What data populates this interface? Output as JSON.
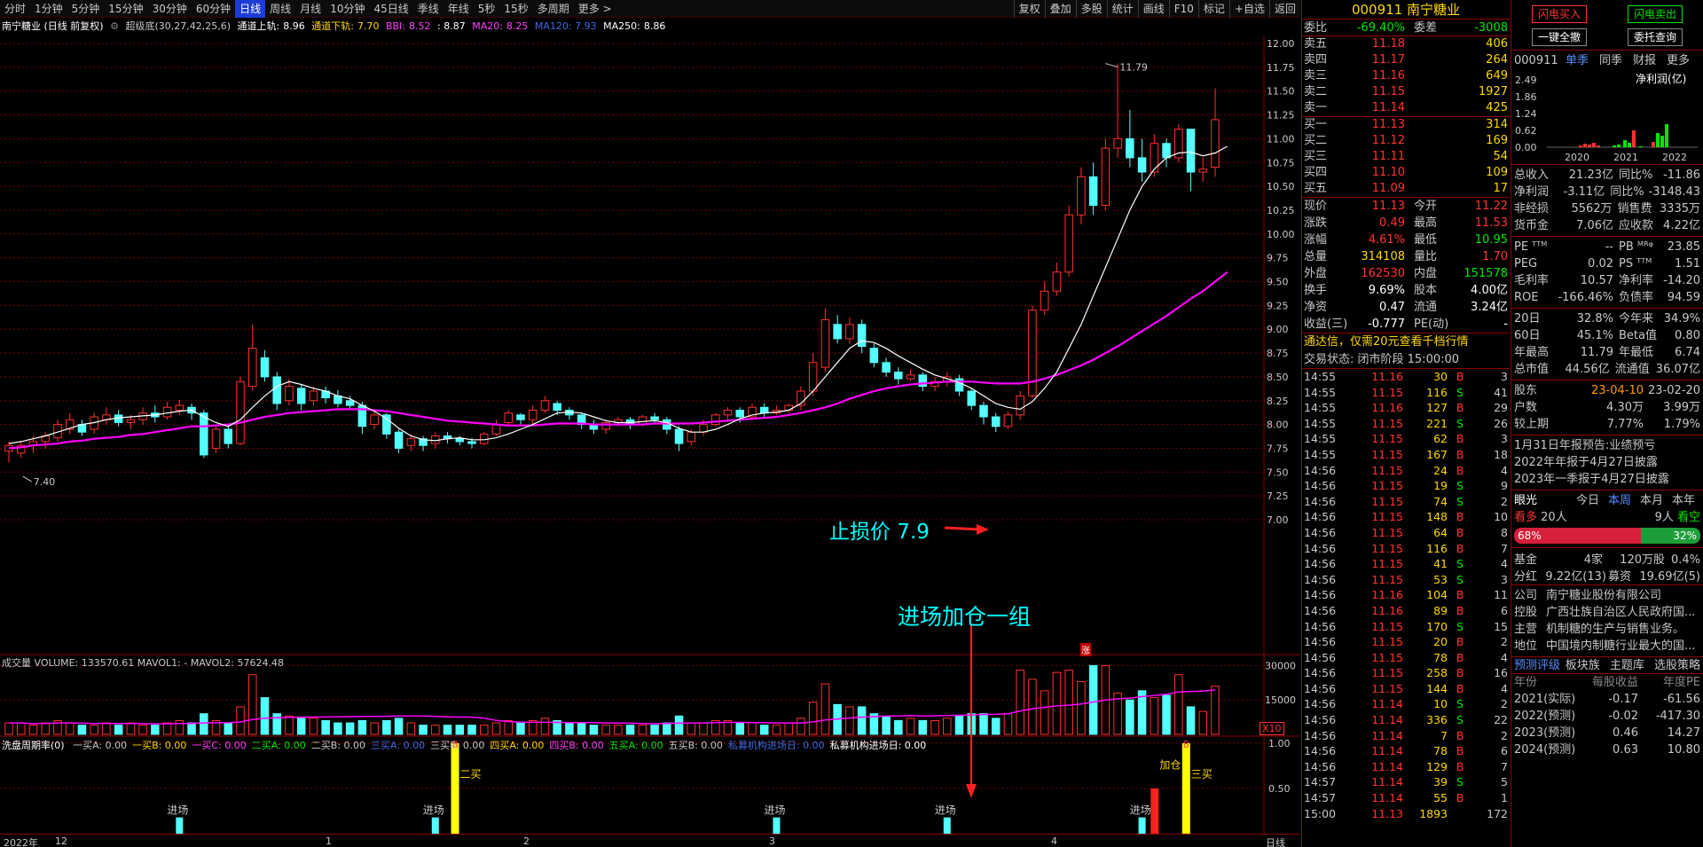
{
  "toolbar": {
    "tabs": [
      "分时",
      "1分钟",
      "5分钟",
      "15分钟",
      "30分钟",
      "60分钟",
      "日线",
      "周线",
      "月线",
      "10分钟",
      "45日线",
      "季线",
      "年线",
      "5秒",
      "15秒",
      "多周期",
      "更多 >"
    ],
    "active": 6,
    "right_buttons": [
      "复权",
      "叠加",
      "多股",
      "统计",
      "画线",
      "F10",
      "标记",
      "+自选",
      "返回"
    ]
  },
  "infoline": {
    "stock": "南宁糖业 (日线 前复权)",
    "indicator": "超级底(30,27,42,25,6)",
    "tdsg_label": "通道上轨:",
    "tdsg": "8.96",
    "tdxg_label": "通道下轨:",
    "tdxg": "7.70",
    "bbi_label": "BBI:",
    "bbi": "8.52",
    "colon_val": ": 8.87",
    "ma20_label": "MA20:",
    "ma20": "8.25",
    "ma120": "MA120: 7.93",
    "ma250_label": "MA250:",
    "ma250": "8.86"
  },
  "price_axis": [
    "12.00",
    "11.75",
    "11.50",
    "11.25",
    "11.00",
    "10.75",
    "10.50",
    "10.25",
    "10.00",
    "9.75",
    "9.50",
    "9.25",
    "9.00",
    "8.75",
    "8.50",
    "8.25",
    "8.00",
    "7.75",
    "7.50",
    "7.25",
    "7.00"
  ],
  "annotations": {
    "high": "11.79",
    "low": "7.40",
    "stop_loss": "止损价 7.9",
    "enter_add": "进场加仓一组",
    "zhang": "涨"
  },
  "volume_panel": {
    "title": "成交量 VOLUME: 133570.61 MAVOL1: - MAVOL2: 57624.48",
    "axis": [
      "30000",
      "15000"
    ],
    "x10": "X10"
  },
  "indicator_panel": {
    "title": "洗盘周期率(0)",
    "items": [
      "一买A: 0.00",
      "一买B: 0.00",
      "一买C: 0.00",
      "二买A: 0.00",
      "二买B: 0.00",
      "三买A: 0.00",
      "三买B: 0.00",
      "四买A: 0.00",
      "四买B: 0.00",
      "五买A: 0.00",
      "五买B: 0.00",
      "私募机构进场日: 0.00",
      "私募机构进场日: 0.00"
    ],
    "axis": [
      "1.00",
      "0.50"
    ],
    "enter": "进场",
    "add": "加仓",
    "two_buy": "二买",
    "three_buy": "三买",
    "eight": "8"
  },
  "xaxis": {
    "labels": [
      "2022年",
      "12",
      "1",
      "2",
      "3",
      "4"
    ],
    "period": "日线"
  },
  "candles": [
    [
      7.72,
      7.78,
      7.6,
      7.82
    ],
    [
      7.7,
      7.78,
      7.65,
      7.83
    ],
    [
      7.78,
      7.82,
      7.7,
      7.88
    ],
    [
      7.82,
      7.88,
      7.75,
      7.92
    ],
    [
      7.86,
      8.0,
      7.82,
      8.05
    ],
    [
      7.95,
      8.05,
      7.9,
      8.12
    ],
    [
      8.0,
      7.92,
      7.88,
      8.05
    ],
    [
      7.95,
      8.08,
      7.9,
      8.12
    ],
    [
      8.05,
      8.1,
      8.0,
      8.18
    ],
    [
      8.1,
      8.02,
      7.98,
      8.15
    ],
    [
      8.02,
      8.05,
      7.95,
      8.1
    ],
    [
      8.05,
      8.12,
      8.0,
      8.18
    ],
    [
      8.12,
      8.08,
      8.02,
      8.2
    ],
    [
      8.08,
      8.18,
      8.05,
      8.24
    ],
    [
      8.15,
      8.2,
      8.1,
      8.26
    ],
    [
      8.18,
      8.12,
      8.05,
      8.22
    ],
    [
      8.12,
      7.68,
      7.65,
      8.15
    ],
    [
      7.75,
      7.95,
      7.7,
      8.0
    ],
    [
      7.95,
      7.8,
      7.75,
      8.0
    ],
    [
      7.8,
      8.45,
      7.78,
      8.5
    ],
    [
      8.4,
      8.8,
      8.35,
      9.05
    ],
    [
      8.7,
      8.5,
      8.45,
      8.78
    ],
    [
      8.5,
      8.22,
      8.15,
      8.55
    ],
    [
      8.25,
      8.4,
      8.2,
      8.48
    ],
    [
      8.38,
      8.22,
      8.15,
      8.42
    ],
    [
      8.25,
      8.35,
      8.2,
      8.4
    ],
    [
      8.35,
      8.28,
      8.22,
      8.4
    ],
    [
      8.3,
      8.22,
      8.18,
      8.36
    ],
    [
      8.25,
      8.2,
      8.15,
      8.3
    ],
    [
      8.2,
      7.98,
      7.9,
      8.24
    ],
    [
      8.0,
      8.1,
      7.95,
      8.15
    ],
    [
      8.1,
      7.9,
      7.85,
      8.12
    ],
    [
      7.92,
      7.75,
      7.7,
      7.95
    ],
    [
      7.78,
      7.85,
      7.72,
      7.9
    ],
    [
      7.85,
      7.78,
      7.72,
      7.88
    ],
    [
      7.8,
      7.88,
      7.75,
      7.92
    ],
    [
      7.88,
      7.85,
      7.8,
      7.92
    ],
    [
      7.85,
      7.82,
      7.78,
      7.88
    ],
    [
      7.82,
      7.8,
      7.75,
      7.86
    ],
    [
      7.8,
      7.9,
      7.78,
      7.92
    ],
    [
      7.9,
      8.0,
      7.88,
      8.05
    ],
    [
      8.02,
      8.12,
      7.98,
      8.15
    ],
    [
      8.1,
      8.05,
      8.0,
      8.12
    ],
    [
      8.05,
      8.15,
      8.0,
      8.2
    ],
    [
      8.15,
      8.25,
      8.12,
      8.3
    ],
    [
      8.22,
      8.15,
      8.1,
      8.25
    ],
    [
      8.15,
      8.1,
      8.05,
      8.18
    ],
    [
      8.1,
      8.0,
      7.95,
      8.12
    ],
    [
      8.0,
      7.95,
      7.9,
      8.05
    ],
    [
      7.95,
      8.02,
      7.9,
      8.05
    ],
    [
      8.02,
      8.05,
      7.98,
      8.08
    ],
    [
      8.05,
      8.0,
      7.95,
      8.08
    ],
    [
      8.0,
      8.08,
      7.98,
      8.1
    ],
    [
      8.08,
      8.05,
      8.02,
      8.12
    ],
    [
      8.05,
      7.95,
      7.9,
      8.08
    ],
    [
      7.95,
      7.8,
      7.72,
      7.98
    ],
    [
      7.82,
      7.92,
      7.78,
      7.95
    ],
    [
      7.92,
      8.0,
      7.88,
      8.05
    ],
    [
      8.0,
      8.1,
      7.98,
      8.12
    ],
    [
      8.1,
      8.15,
      8.05,
      8.18
    ],
    [
      8.15,
      8.08,
      8.02,
      8.18
    ],
    [
      8.08,
      8.18,
      8.05,
      8.22
    ],
    [
      8.18,
      8.12,
      8.08,
      8.22
    ],
    [
      8.12,
      8.15,
      8.1,
      8.2
    ],
    [
      8.15,
      8.2,
      8.12,
      8.22
    ],
    [
      8.2,
      8.35,
      8.15,
      8.4
    ],
    [
      8.35,
      8.65,
      8.3,
      8.75
    ],
    [
      8.6,
      9.1,
      8.55,
      9.22
    ],
    [
      9.05,
      8.9,
      8.85,
      9.15
    ],
    [
      8.9,
      9.05,
      8.85,
      9.12
    ],
    [
      9.05,
      8.82,
      8.75,
      9.1
    ],
    [
      8.8,
      8.65,
      8.6,
      8.85
    ],
    [
      8.65,
      8.55,
      8.5,
      8.7
    ],
    [
      8.55,
      8.48,
      8.42,
      8.6
    ],
    [
      8.48,
      8.52,
      8.45,
      8.58
    ],
    [
      8.52,
      8.4,
      8.35,
      8.55
    ],
    [
      8.4,
      8.45,
      8.35,
      8.5
    ],
    [
      8.45,
      8.5,
      8.4,
      8.55
    ],
    [
      8.48,
      8.35,
      8.3,
      8.52
    ],
    [
      8.35,
      8.2,
      8.15,
      8.38
    ],
    [
      8.2,
      8.08,
      8.0,
      8.24
    ],
    [
      8.08,
      7.98,
      7.92,
      8.12
    ],
    [
      7.98,
      8.1,
      7.95,
      8.14
    ],
    [
      8.1,
      8.3,
      8.05,
      8.35
    ],
    [
      8.3,
      9.2,
      8.28,
      9.25
    ],
    [
      9.2,
      9.4,
      9.15,
      9.5
    ],
    [
      9.4,
      9.6,
      9.35,
      9.7
    ],
    [
      9.6,
      10.2,
      9.55,
      10.3
    ],
    [
      10.2,
      10.6,
      10.1,
      10.7
    ],
    [
      10.6,
      10.3,
      10.2,
      10.75
    ],
    [
      10.3,
      10.9,
      10.25,
      11.0
    ],
    [
      10.9,
      11.0,
      10.8,
      11.79
    ],
    [
      11.0,
      10.8,
      10.7,
      11.3
    ],
    [
      10.8,
      10.65,
      10.55,
      11.0
    ],
    [
      10.65,
      10.95,
      10.6,
      11.05
    ],
    [
      10.95,
      10.8,
      10.7,
      11.0
    ],
    [
      10.8,
      11.1,
      10.75,
      11.15
    ],
    [
      11.1,
      10.65,
      10.45,
      11.05
    ],
    [
      10.65,
      10.68,
      10.55,
      10.8
    ],
    [
      10.7,
      11.2,
      10.6,
      11.53
    ]
  ],
  "ma_white": [
    7.8,
    7.82,
    7.85,
    7.88,
    7.92,
    7.96,
    8.0,
    8.02,
    8.05,
    8.07,
    8.08,
    8.09,
    8.1,
    8.12,
    8.14,
    8.15,
    8.08,
    8.02,
    7.98,
    8.05,
    8.18,
    8.3,
    8.4,
    8.45,
    8.42,
    8.38,
    8.35,
    8.3,
    8.27,
    8.2,
    8.14,
    8.06,
    7.96,
    7.88,
    7.84,
    7.83,
    7.85,
    7.86,
    7.84,
    7.84,
    7.86,
    7.9,
    7.95,
    8.0,
    8.06,
    8.12,
    8.13,
    8.12,
    8.08,
    8.04,
    8.02,
    8.02,
    8.03,
    8.04,
    8.02,
    7.96,
    7.92,
    7.92,
    7.95,
    8.0,
    8.06,
    8.1,
    8.12,
    8.13,
    8.15,
    8.22,
    8.35,
    8.5,
    8.65,
    8.8,
    8.88,
    8.86,
    8.8,
    8.72,
    8.65,
    8.58,
    8.52,
    8.48,
    8.44,
    8.38,
    8.3,
    8.22,
    8.18,
    8.16,
    8.24,
    8.38,
    8.55,
    8.8,
    9.05,
    9.35,
    9.65,
    9.95,
    10.25,
    10.5,
    10.68,
    10.8,
    10.85,
    10.86,
    10.82,
    10.85,
    10.92
  ],
  "ma_magenta": [
    7.75,
    7.76,
    7.78,
    7.79,
    7.8,
    7.82,
    7.83,
    7.85,
    7.86,
    7.87,
    7.89,
    7.9,
    7.92,
    7.94,
    7.96,
    7.98,
    7.98,
    7.99,
    8.0,
    8.02,
    8.05,
    8.08,
    8.1,
    8.12,
    8.13,
    8.14,
    8.15,
    8.16,
    8.16,
    8.16,
    8.15,
    8.14,
    8.12,
    8.1,
    8.08,
    8.06,
    8.04,
    8.03,
    8.02,
    8.01,
    8.0,
    7.99,
    7.99,
    7.99,
    8.0,
    8.01,
    8.01,
    8.01,
    8.0,
    8.0,
    8.0,
    8.0,
    8.0,
    8.01,
    8.01,
    8.01,
    8.01,
    8.02,
    8.03,
    8.04,
    8.05,
    8.06,
    8.07,
    8.08,
    8.1,
    8.12,
    8.15,
    8.18,
    8.22,
    8.27,
    8.31,
    8.35,
    8.38,
    8.4,
    8.42,
    8.43,
    8.44,
    8.45,
    8.45,
    8.45,
    8.44,
    8.43,
    8.43,
    8.43,
    8.45,
    8.48,
    8.52,
    8.57,
    8.62,
    8.68,
    8.75,
    8.82,
    8.9,
    8.98,
    9.06,
    9.14,
    9.23,
    9.32,
    9.4,
    9.5,
    9.6
  ],
  "volumes": [
    5,
    5,
    4,
    5,
    6,
    5,
    4,
    4,
    5,
    4,
    5,
    4,
    4,
    5,
    6,
    5,
    9,
    6,
    5,
    12,
    26,
    16,
    9,
    8,
    7,
    7,
    6,
    5,
    5,
    6,
    5,
    6,
    7,
    5,
    4,
    4,
    4,
    4,
    4,
    4,
    5,
    6,
    5,
    6,
    7,
    6,
    5,
    5,
    4,
    4,
    4,
    4,
    4,
    4,
    5,
    8,
    5,
    5,
    6,
    6,
    5,
    5,
    4,
    4,
    5,
    7,
    14,
    22,
    13,
    12,
    12,
    9,
    8,
    6,
    7,
    6,
    6,
    7,
    8,
    9,
    9,
    7,
    9,
    28,
    24,
    19,
    27,
    28,
    23,
    30,
    30,
    18,
    15,
    19,
    16,
    17,
    26,
    12,
    10,
    21
  ],
  "quote": {
    "code": "000911",
    "name": "南宁糖业",
    "wb_label": "委比",
    "wb": "-69.40%",
    "wc_label": "委差",
    "wc": "-3008",
    "asks": [
      [
        "卖五",
        "11.18",
        "406"
      ],
      [
        "卖四",
        "11.17",
        "264"
      ],
      [
        "卖三",
        "11.16",
        "649"
      ],
      [
        "卖二",
        "11.15",
        "1927"
      ],
      [
        "卖一",
        "11.14",
        "425"
      ]
    ],
    "bids": [
      [
        "买一",
        "11.13",
        "314"
      ],
      [
        "买二",
        "11.12",
        "169"
      ],
      [
        "买三",
        "11.11",
        "54"
      ],
      [
        "买四",
        "11.10",
        "109"
      ],
      [
        "买五",
        "11.09",
        "17"
      ]
    ],
    "stats": [
      [
        "现价",
        "11.13",
        "今开",
        "11.22"
      ],
      [
        "涨跌",
        "0.49",
        "最高",
        "11.53"
      ],
      [
        "涨幅",
        "4.61%",
        "最低",
        "10.95"
      ],
      [
        "总量",
        "314108",
        "量比",
        "1.70"
      ],
      [
        "外盘",
        "162530",
        "内盘",
        "151578"
      ],
      [
        "换手",
        "9.69%",
        "股本",
        "4.00亿"
      ],
      [
        "净资",
        "0.47",
        "流通",
        "3.24亿"
      ],
      [
        "收益(三)",
        "-0.777",
        "PE(动)",
        "-"
      ]
    ],
    "ad": "通达信，仅需20元查看千档行情",
    "trade_status": "交易状态: 闭市阶段 15:00:00",
    "ticks": [
      [
        "14:55",
        "11.16",
        "30",
        "B",
        "3"
      ],
      [
        "14:55",
        "11.15",
        "116",
        "S",
        "41"
      ],
      [
        "14:55",
        "11.16",
        "127",
        "B",
        "29"
      ],
      [
        "14:55",
        "11.15",
        "221",
        "S",
        "26"
      ],
      [
        "14:55",
        "11.15",
        "62",
        "B",
        "3"
      ],
      [
        "14:55",
        "11.15",
        "167",
        "B",
        "18"
      ],
      [
        "14:56",
        "11.15",
        "24",
        "B",
        "4"
      ],
      [
        "14:56",
        "11.15",
        "19",
        "S",
        "9"
      ],
      [
        "14:56",
        "11.15",
        "74",
        "S",
        "2"
      ],
      [
        "14:56",
        "11.15",
        "148",
        "B",
        "10"
      ],
      [
        "14:56",
        "11.15",
        "64",
        "B",
        "8"
      ],
      [
        "14:56",
        "11.15",
        "116",
        "B",
        "7"
      ],
      [
        "14:56",
        "11.15",
        "41",
        "S",
        "4"
      ],
      [
        "14:56",
        "11.15",
        "53",
        "S",
        "3"
      ],
      [
        "14:56",
        "11.16",
        "104",
        "B",
        "11"
      ],
      [
        "14:56",
        "11.16",
        "89",
        "B",
        "6"
      ],
      [
        "14:56",
        "11.15",
        "170",
        "S",
        "15"
      ],
      [
        "14:56",
        "11.15",
        "20",
        "B",
        "2"
      ],
      [
        "14:56",
        "11.15",
        "78",
        "B",
        "4"
      ],
      [
        "14:56",
        "11.15",
        "258",
        "B",
        "16"
      ],
      [
        "14:56",
        "11.15",
        "144",
        "B",
        "4"
      ],
      [
        "14:56",
        "11.14",
        "10",
        "S",
        "2"
      ],
      [
        "14:56",
        "11.14",
        "336",
        "S",
        "22"
      ],
      [
        "14:56",
        "11.14",
        "7",
        "B",
        "2"
      ],
      [
        "14:56",
        "11.14",
        "78",
        "B",
        "6"
      ],
      [
        "14:56",
        "11.14",
        "129",
        "B",
        "7"
      ],
      [
        "14:57",
        "11.14",
        "39",
        "S",
        "5"
      ],
      [
        "14:57",
        "11.14",
        "55",
        "B",
        "1"
      ],
      [
        "15:00",
        "11.13",
        "1893",
        "",
        "172"
      ]
    ]
  },
  "f10": {
    "btn_flash_buy": "闪电买入",
    "btn_flash_sell": "闪电卖出",
    "btn_cancel_all": "一键全撤",
    "btn_query": "委托查询",
    "code": "000911",
    "tabs": [
      "单季",
      "同季",
      "财报",
      "更多"
    ],
    "chart_title": "净利润(亿)",
    "chart_axis": [
      "2.49",
      "1.86",
      "1.24",
      "0.62",
      "0.00"
    ],
    "years": [
      "2020",
      "2021",
      "2022"
    ],
    "fin": [
      [
        "总收入",
        "21.23亿",
        "同比%",
        "-11.86"
      ],
      [
        "净利润",
        "-3.11亿",
        "同比%",
        "-3148.43"
      ],
      [
        "非经损",
        "5562万",
        "销售费",
        "3335万"
      ],
      [
        "货币金",
        "7.06亿",
        "应收款",
        "4.22亿"
      ]
    ],
    "val": [
      [
        "PE ᵀᵀᴹ",
        "--",
        "PB ᴹᴿᵠ",
        "23.85"
      ],
      [
        "PEG",
        "0.02",
        "PS ᵀᵀᴹ",
        "1.51"
      ],
      [
        "毛利率",
        "10.57",
        "净利率",
        "-14.20"
      ],
      [
        "ROE",
        "-166.46%",
        "负债率",
        "94.59"
      ]
    ],
    "perf": [
      [
        "20日",
        "32.8%",
        "今年来",
        "34.9%"
      ],
      [
        "60日",
        "45.1%",
        "Beta值",
        "0.80"
      ],
      [
        "年最高",
        "11.79",
        "年最低",
        "6.74"
      ],
      [
        "总市值",
        "44.56亿",
        "流通值",
        "36.07亿"
      ]
    ],
    "holders": [
      [
        "股东",
        "23-04-10",
        "23-02-20"
      ],
      [
        "户数",
        "4.30万",
        "3.99万"
      ],
      [
        "较上期",
        "7.77%",
        "1.79%"
      ]
    ],
    "notices": [
      "1月31日年报预告:业绩预亏",
      "2022年年报于4月27日披露",
      "2023年一季报于4月27日披露"
    ],
    "eye_label": "眼光",
    "periods": [
      "今日",
      "本周",
      "本月",
      "本年"
    ],
    "bull": "看多",
    "bull_n": "20人",
    "bear": "看空",
    "bear_n": "9人",
    "bull_pct": "68%",
    "bear_pct": "32%",
    "bull_ratio": 0.68,
    "fund": [
      "基金",
      "4家",
      "120万股",
      "0.4%"
    ],
    "div": [
      "分红",
      "9.22亿(13)",
      "募资",
      "19.69亿(5)"
    ],
    "company": [
      [
        "公司",
        "南宁糖业股份有限公司"
      ],
      [
        "控股",
        "广西壮族自治区人民政府国..."
      ],
      [
        "主营",
        "机制糖的生产与销售业务。"
      ],
      [
        "地位",
        "中国境内制糖行业最大的国..."
      ]
    ],
    "tabs2": [
      "预测评级",
      "板块族",
      "主题库",
      "选股策略"
    ],
    "fc_head": [
      "年份",
      "每股收益",
      "年度PE"
    ],
    "forecast": [
      [
        "2021(实际)",
        "-0.17",
        "-61.56"
      ],
      [
        "2022(预测)",
        "-0.02",
        "-417.30"
      ],
      [
        "2023(预测)",
        "0.46",
        "14.27"
      ],
      [
        "2024(预测)",
        "0.63",
        "10.80"
      ]
    ]
  }
}
